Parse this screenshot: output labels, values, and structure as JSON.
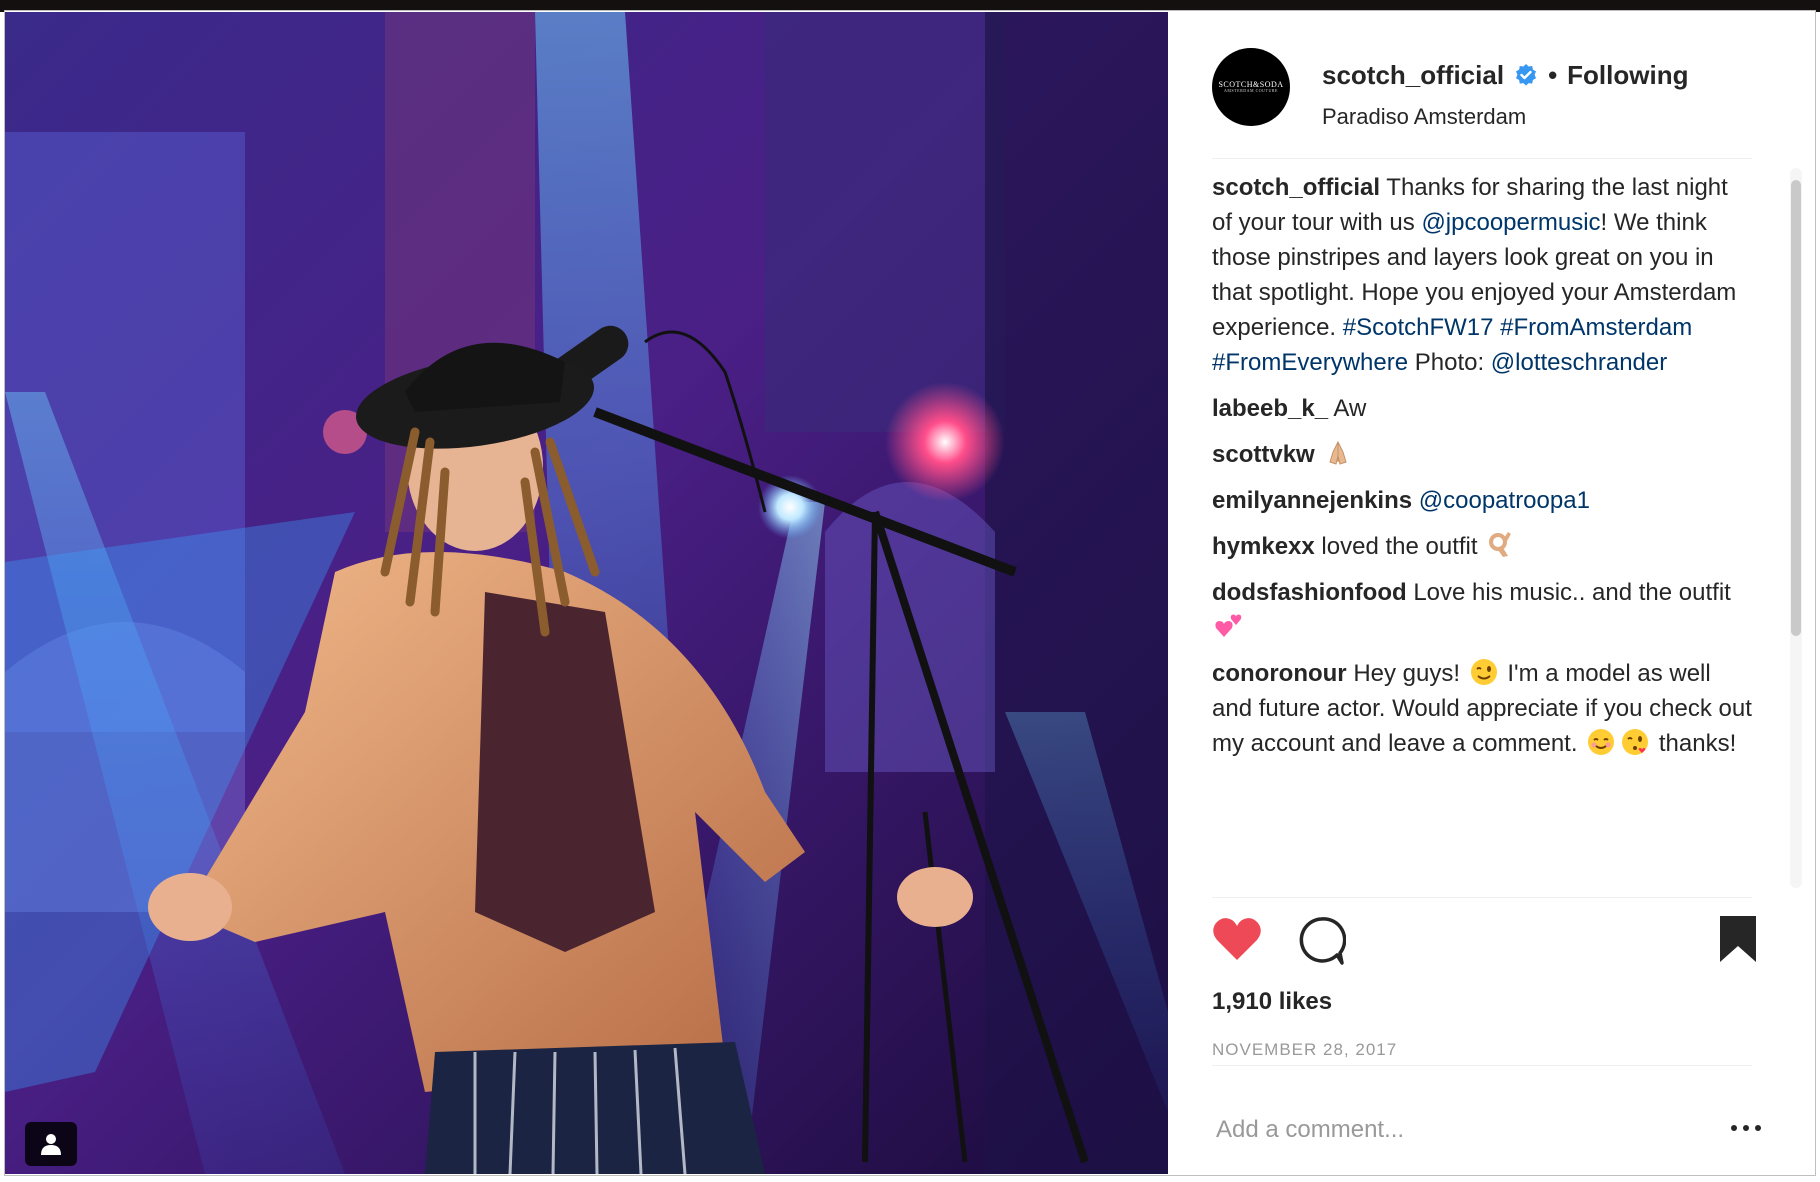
{
  "post": {
    "username": "scotch_official",
    "verified": true,
    "separator": "•",
    "follow_status": "Following",
    "location": "Paradiso Amsterdam",
    "avatar_text": "SCOTCH&SODA",
    "avatar_subtext": "AMSTERDAM COUTURE"
  },
  "caption": {
    "user": "scotch_official",
    "text_1": "Thanks for sharing the last night of your tour with us ",
    "mention_1": "@jpcoopermusic",
    "text_2": "! We think those pinstripes and layers look great on you in that spotlight. Hope you enjoyed your Amsterdam experience. ",
    "hashtag_1": "#ScotchFW17",
    "hashtag_2": "#FromAmsterdam",
    "hashtag_3": "#FromEverywhere",
    "text_3": "Photo: ",
    "mention_2": "@lotteschrander"
  },
  "comments": [
    {
      "user": "labeeb_k_",
      "text": "Aw"
    },
    {
      "user": "scottvkw",
      "emoji": "folded-hands-emoji"
    },
    {
      "user": "emilyannejenkins",
      "mention": "@coopatroopa1"
    },
    {
      "user": "hymkexx",
      "text": "loved the outfit",
      "emoji": "ok-hand-emoji"
    },
    {
      "user": "dodsfashionfood",
      "text": "Love his music.. and the outfit",
      "emoji": "two-hearts-emoji"
    },
    {
      "user": "conoronour",
      "text_1": "Hey guys!",
      "text_2": "I'm a model as well and future actor. Would appreciate if you check out my account and leave a comment.",
      "text_3": "thanks!",
      "emojis": [
        "winking-face-emoji",
        "smiling-face-emoji",
        "face-blowing-kiss-emoji"
      ]
    }
  ],
  "likes": "1,910 likes",
  "date": "NOVEMBER 28, 2017",
  "add_comment": {
    "placeholder": "Add a comment..."
  },
  "icons": {
    "like": "heart-icon",
    "comment": "comment-icon",
    "save": "bookmark-icon",
    "more": "more-options-icon",
    "tag": "user-tag-icon",
    "verified": "verified-badge-icon"
  },
  "colors": {
    "like_red": "#ed4956",
    "link_blue": "#003569",
    "verified_blue": "#3897f0",
    "secondary_gray": "#999999"
  }
}
